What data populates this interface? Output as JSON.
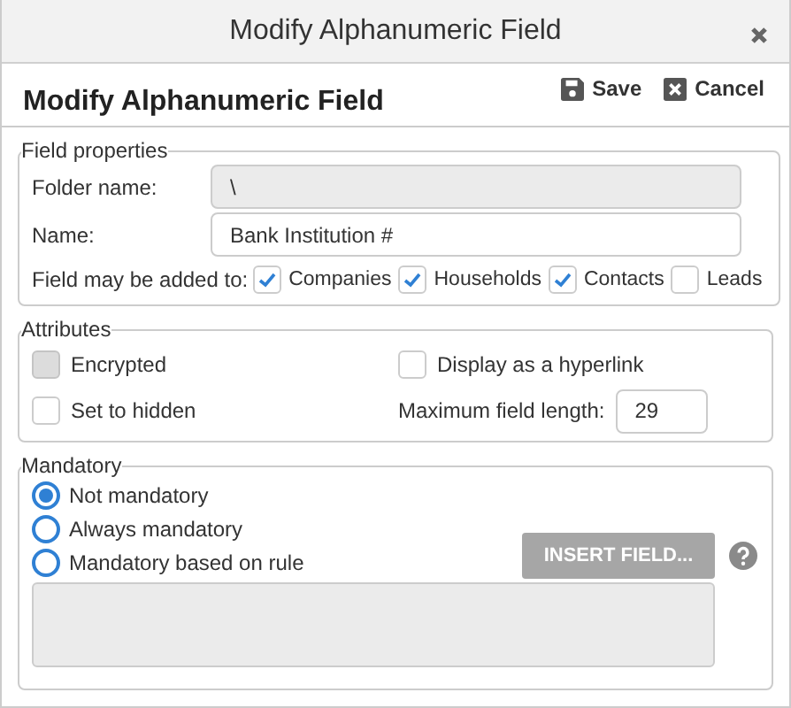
{
  "window": {
    "title": "Modify Alphanumeric Field"
  },
  "header": {
    "title": "Modify Alphanumeric Field",
    "actions": [
      {
        "kind": "save",
        "label": "Save"
      },
      {
        "kind": "cancel",
        "label": "Cancel"
      }
    ]
  },
  "field_properties": {
    "legend": "Field properties",
    "folder_name": {
      "label": "Folder name:",
      "value": "\\",
      "disabled": true
    },
    "name": {
      "label": "Name:",
      "value": "Bank Institution #"
    },
    "added_to": {
      "label": "Field may be added to:",
      "options": [
        {
          "label": "Companies",
          "checked": true
        },
        {
          "label": "Households",
          "checked": true
        },
        {
          "label": "Contacts",
          "checked": true
        },
        {
          "label": "Leads",
          "checked": false
        }
      ]
    }
  },
  "attributes": {
    "legend": "Attributes",
    "items": [
      {
        "kind": "checkbox",
        "label": "Encrypted",
        "checked": false,
        "disabled": true
      },
      {
        "kind": "checkbox",
        "label": "Display as a hyperlink",
        "checked": false,
        "disabled": false
      },
      {
        "kind": "checkbox",
        "label": "Set to hidden",
        "checked": false,
        "disabled": false
      },
      {
        "kind": "number",
        "label": "Maximum field length:",
        "value": "29"
      }
    ]
  },
  "mandatory": {
    "legend": "Mandatory",
    "options": [
      {
        "label": "Not mandatory",
        "selected": true
      },
      {
        "label": "Always mandatory",
        "selected": false
      },
      {
        "label": "Mandatory based on rule",
        "selected": false
      }
    ],
    "insert_button": {
      "label": "INSERT FIELD...",
      "disabled": true
    },
    "rule_box": {
      "disabled": true
    }
  }
}
